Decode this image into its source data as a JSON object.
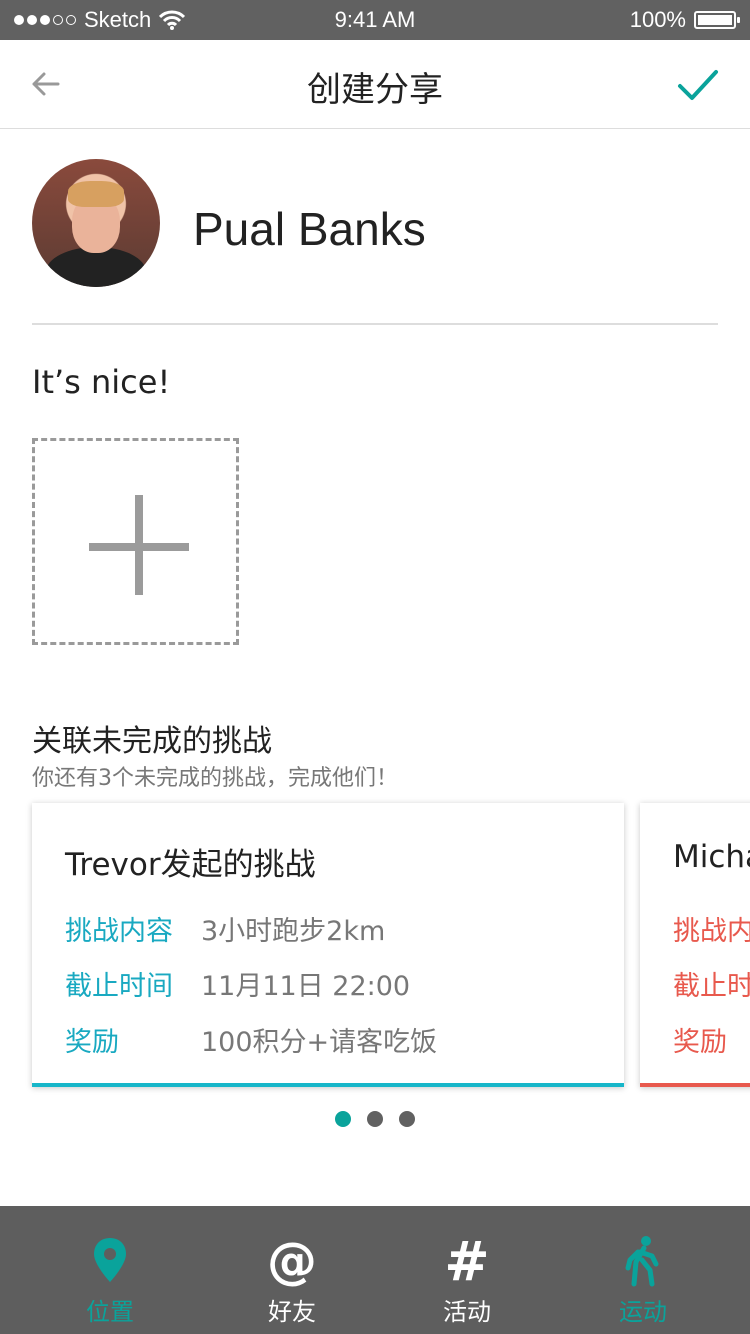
{
  "status_bar": {
    "carrier": "Sketch",
    "time": "9:41 AM",
    "battery": "100%"
  },
  "nav": {
    "title": "创建分享",
    "back_icon": "arrow-left-icon",
    "confirm_icon": "check-icon",
    "accent": "#0aa39b"
  },
  "profile": {
    "name": "Pual Banks"
  },
  "post": {
    "comment": "It’s nice!"
  },
  "challenges": {
    "title": "关联未完成的挑战",
    "subtitle": "你还有3个未完成的挑战，完成他们！",
    "cards": [
      {
        "title": "Trevor发起的挑战",
        "accent": "#17b6c9",
        "rows": [
          {
            "key": "挑战内容",
            "value": "3小时跑步2km"
          },
          {
            "key": "截止时间",
            "value": "11月11日 22:00"
          },
          {
            "key": "奖励",
            "value": "100积分+请客吃饭"
          }
        ]
      },
      {
        "title": "Micha",
        "accent": "#e8594d",
        "rows": [
          {
            "key": "挑战内"
          },
          {
            "key": "截止时"
          },
          {
            "key": "奖励"
          }
        ]
      }
    ],
    "pager": {
      "count": 3,
      "active": 1
    }
  },
  "tabs": [
    {
      "label": "位置",
      "icon": "location-pin-icon",
      "color": "#0aa39b"
    },
    {
      "label": "好友",
      "icon": "at-sign-icon",
      "color": "#ffffff"
    },
    {
      "label": "活动",
      "icon": "hashtag-icon",
      "color": "#ffffff"
    },
    {
      "label": "运动",
      "icon": "walking-person-icon",
      "color": "#0aa39b"
    }
  ]
}
